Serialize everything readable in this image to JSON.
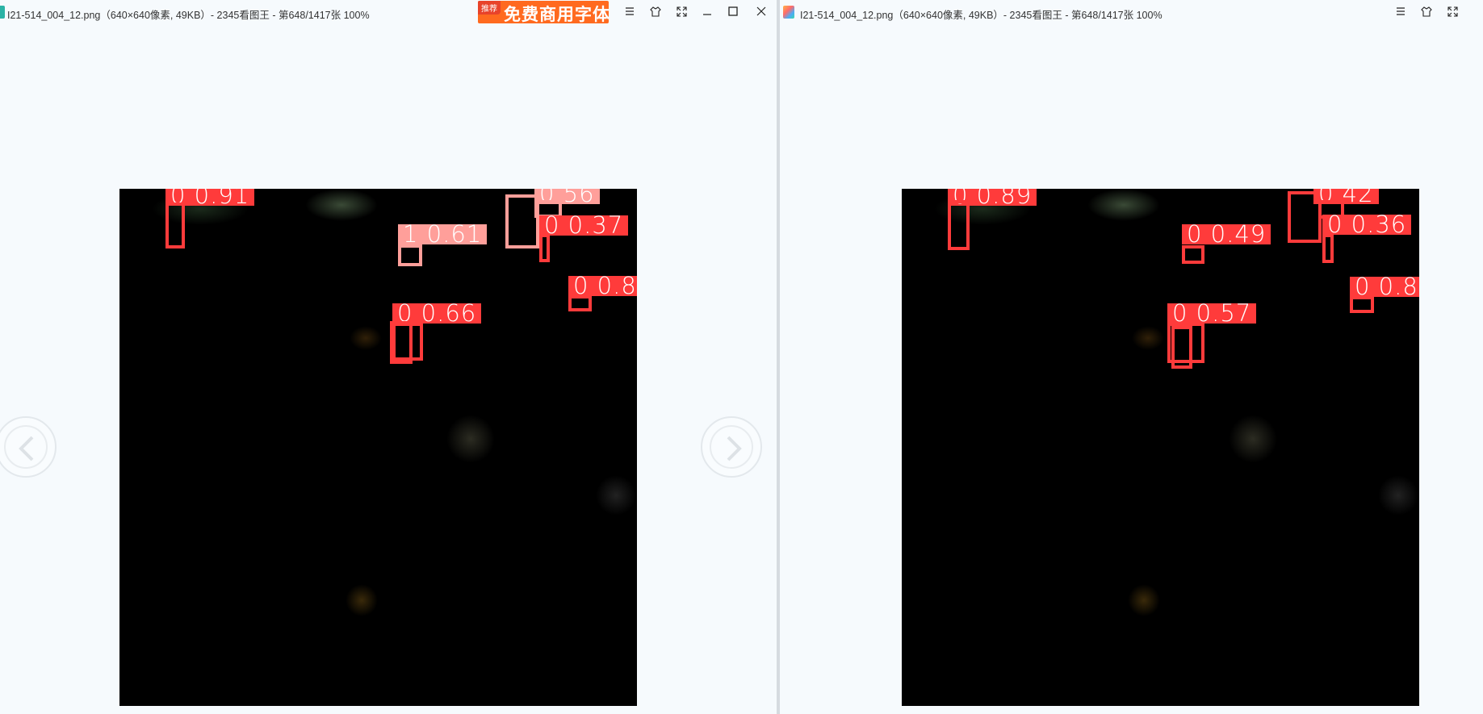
{
  "left_window": {
    "title": "I21-514_004_12.png（640×640像素, 49KB）- 2345看图王 - 第648/1417张 100%",
    "promo": {
      "tag": "推荐",
      "text": "免费商用字体"
    },
    "icons": [
      "menu-icon",
      "skin-icon",
      "fullscreen-icon",
      "minimize-icon",
      "maximize-icon",
      "close-icon"
    ],
    "detections": [
      {
        "label": "0 0.91",
        "color": "red"
      },
      {
        "label": "0.56",
        "color": "pink"
      },
      {
        "label": "0 0.37",
        "color": "red"
      },
      {
        "label": "1 0.61",
        "color": "pink"
      },
      {
        "label": "0 0.8",
        "color": "red"
      },
      {
        "label": "0 0.66",
        "color": "red"
      }
    ],
    "nav": {
      "prev": "chevron-left-icon",
      "next": "chevron-right-icon"
    }
  },
  "right_window": {
    "title": "I21-514_004_12.png（640×640像素, 49KB）- 2345看图王 - 第648/1417张 100%",
    "icons": [
      "menu-icon",
      "skin-icon",
      "fullscreen-icon"
    ],
    "detections": [
      {
        "label": "0 0.89",
        "color": "red"
      },
      {
        "label": "0.42",
        "color": "red"
      },
      {
        "label": "0 0.36",
        "color": "red"
      },
      {
        "label": "0 0.49",
        "color": "red"
      },
      {
        "label": "0 0.8",
        "color": "red"
      },
      {
        "label": "0 0.57",
        "color": "red"
      }
    ]
  },
  "colors": {
    "background": "#f6fafd",
    "box_red": "#ff3b3b",
    "box_pink": "#ff9f9a",
    "promo": "#ff6a1f"
  }
}
